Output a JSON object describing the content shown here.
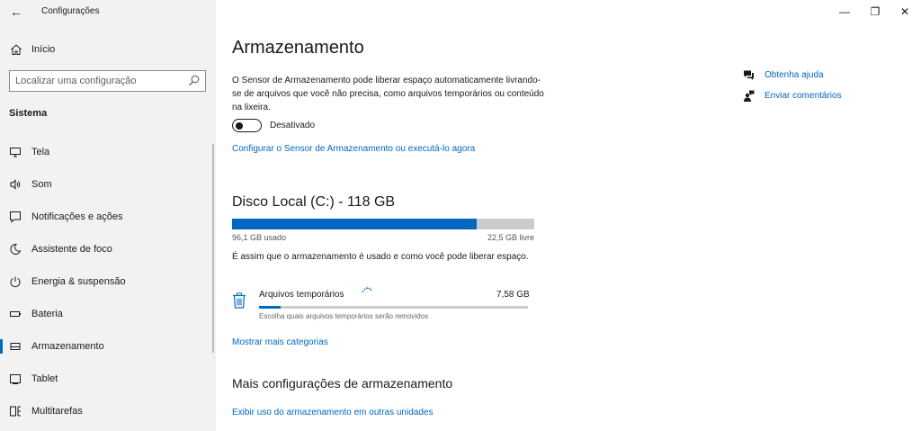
{
  "window": {
    "title": "Configurações",
    "controls": {
      "minimize": "—",
      "restore": "❐",
      "close": "✕"
    },
    "back_icon": "←"
  },
  "sidebar": {
    "home_label": "Início",
    "search_placeholder": "Localizar uma configuração",
    "section_label": "Sistema",
    "items": [
      {
        "label": "Tela",
        "icon": "monitor-icon"
      },
      {
        "label": "Som",
        "icon": "speaker-icon"
      },
      {
        "label": "Notificações e ações",
        "icon": "notification-icon"
      },
      {
        "label": "Assistente de foco",
        "icon": "moon-icon"
      },
      {
        "label": "Energia & suspensão",
        "icon": "power-icon"
      },
      {
        "label": "Bateria",
        "icon": "battery-icon"
      },
      {
        "label": "Armazenamento",
        "icon": "storage-icon",
        "active": true
      },
      {
        "label": "Tablet",
        "icon": "tablet-icon"
      },
      {
        "label": "Multitarefas",
        "icon": "multitasking-icon"
      }
    ]
  },
  "main": {
    "title": "Armazenamento",
    "description": "O Sensor de Armazenamento pode liberar espaço automaticamente livrando-se de arquivos que você não precisa, como arquivos temporários ou conteúdo na lixeira.",
    "toggle_label": "Desativado",
    "toggle_state": false,
    "configure_link": "Configurar o Sensor de Armazenamento ou executá-lo agora",
    "disk": {
      "title": "Disco Local (C:) - 118 GB",
      "used_label": "96,1 GB usado",
      "free_label": "22,5 GB livre",
      "used_fraction": 0.81,
      "description": "É assim que o armazenamento é usado e como você pode liberar espaço."
    },
    "category": {
      "name": "Arquivos temporários",
      "size": "7,58 GB",
      "subtitle": "Escolha quais arquivos temporários serão removidos",
      "fraction": 0.08
    },
    "more_categories_link": "Mostrar mais categorias",
    "more_settings_title": "Mais configurações de armazenamento",
    "other_drives_link": "Exibir uso do armazenamento em outras unidades"
  },
  "help": {
    "get_help": "Obtenha ajuda",
    "feedback": "Enviar comentários"
  },
  "colors": {
    "accent": "#0067c0",
    "sidebar_bg": "#f2f2f2",
    "bar_bg": "#cccccc"
  }
}
